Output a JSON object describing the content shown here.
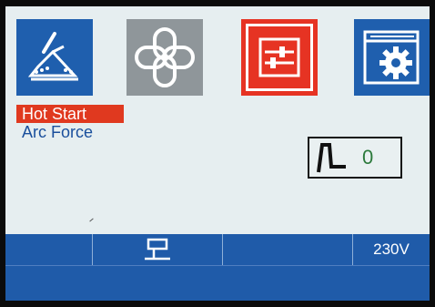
{
  "tabs": [
    {
      "name": "weld-mode",
      "icon": "electrode-weld-icon"
    },
    {
      "name": "link",
      "icon": "link-cross-icon"
    },
    {
      "name": "parameters",
      "icon": "sliders-icon",
      "selected": true
    },
    {
      "name": "settings",
      "icon": "window-gear-icon"
    }
  ],
  "menu": {
    "items": [
      {
        "label": "Hot Start",
        "selected": true
      },
      {
        "label": "Arc  Force",
        "selected": false
      }
    ]
  },
  "value_panel": {
    "icon": "pulse-waveform-icon",
    "value": "0"
  },
  "status_bar": {
    "cells": [
      {
        "text": ""
      },
      {
        "icon": "torch-holder-icon"
      },
      {
        "text": ""
      },
      {
        "text": "230V"
      }
    ]
  },
  "colors": {
    "screen_bg": "#e6eef0",
    "tab_blue": "#1f5fae",
    "tab_gray": "#8f969a",
    "accent_red": "#e63323",
    "status_blue": "#1f5ba9",
    "value_green": "#2c7a3c"
  }
}
